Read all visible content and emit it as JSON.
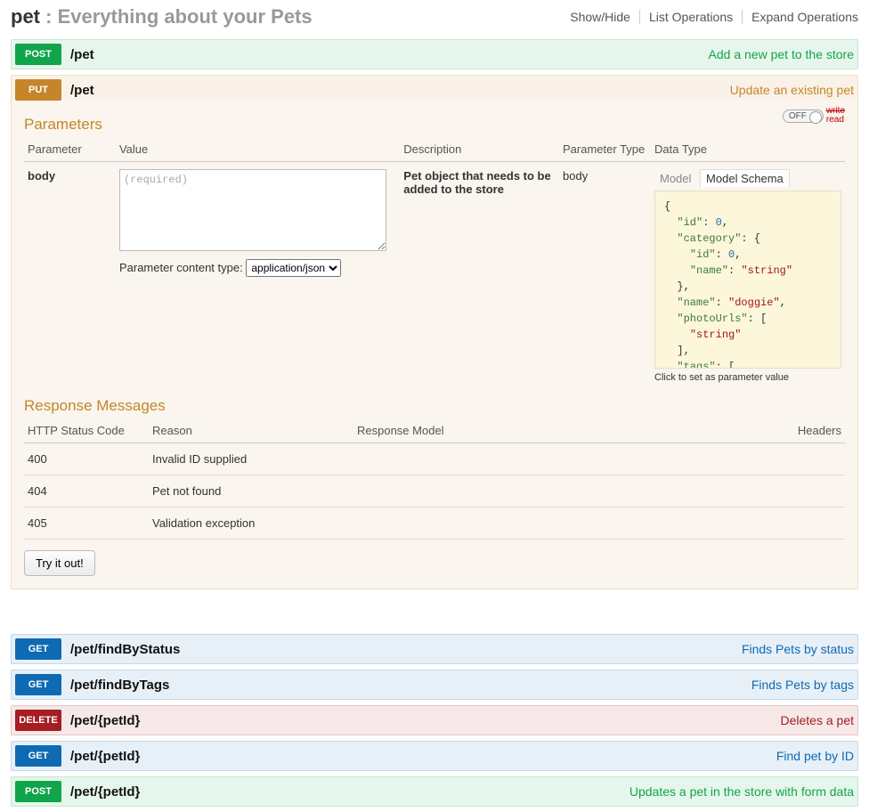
{
  "resource": {
    "name": "pet",
    "separator": " : ",
    "description": "Everything about your Pets",
    "ops": [
      "Show/Hide",
      "List Operations",
      "Expand Operations"
    ]
  },
  "ops_collapsed_top": [
    {
      "method": "POST",
      "cls": "op-post",
      "path": "/pet",
      "summary": "Add a new pet to the store"
    }
  ],
  "expanded": {
    "method": "PUT",
    "cls": "op-put",
    "path": "/pet",
    "summary": "Update an existing pet",
    "toggle": {
      "switch": "OFF",
      "write": "write",
      "read": "read"
    },
    "sections": {
      "parameters_heading": "Parameters",
      "response_heading": "Response Messages"
    },
    "param_headers": [
      "Parameter",
      "Value",
      "Description",
      "Parameter Type",
      "Data Type"
    ],
    "param": {
      "name": "body",
      "placeholder": "(required)",
      "value": "",
      "content_type_label": "Parameter content type:",
      "content_type_value": "application/json",
      "description": "Pet object that needs to be added to the store",
      "param_type": "body",
      "tabs": {
        "model": "Model",
        "schema": "Model Schema"
      },
      "schema_hint": "Click to set as parameter value",
      "schema": {
        "l1": "{",
        "l2_k": "\"id\"",
        "l2_v": "0",
        "l3_k": "\"category\"",
        "l4_k": "\"id\"",
        "l4_v": "0",
        "l5_k": "\"name\"",
        "l5_v": "\"string\"",
        "l6": "},",
        "l7_k": "\"name\"",
        "l7_v": "\"doggie\"",
        "l8_k": "\"photoUrls\"",
        "l9_v": "\"string\"",
        "l10": "],",
        "l11_k": "\"tags\""
      }
    },
    "resp_headers": [
      "HTTP Status Code",
      "Reason",
      "Response Model",
      "Headers"
    ],
    "responses": [
      {
        "code": "400",
        "reason": "Invalid ID supplied"
      },
      {
        "code": "404",
        "reason": "Pet not found"
      },
      {
        "code": "405",
        "reason": "Validation exception"
      }
    ],
    "tryit_label": "Try it out!"
  },
  "ops_collapsed_bottom": [
    {
      "method": "GET",
      "cls": "op-get",
      "path": "/pet/findByStatus",
      "summary": "Finds Pets by status"
    },
    {
      "method": "GET",
      "cls": "op-get",
      "path": "/pet/findByTags",
      "summary": "Finds Pets by tags"
    },
    {
      "method": "DELETE",
      "cls": "op-delete",
      "path": "/pet/{petId}",
      "summary": "Deletes a pet"
    },
    {
      "method": "GET",
      "cls": "op-get",
      "path": "/pet/{petId}",
      "summary": "Find pet by ID"
    },
    {
      "method": "POST",
      "cls": "op-post",
      "path": "/pet/{petId}",
      "summary": "Updates a pet in the store with form data"
    }
  ]
}
